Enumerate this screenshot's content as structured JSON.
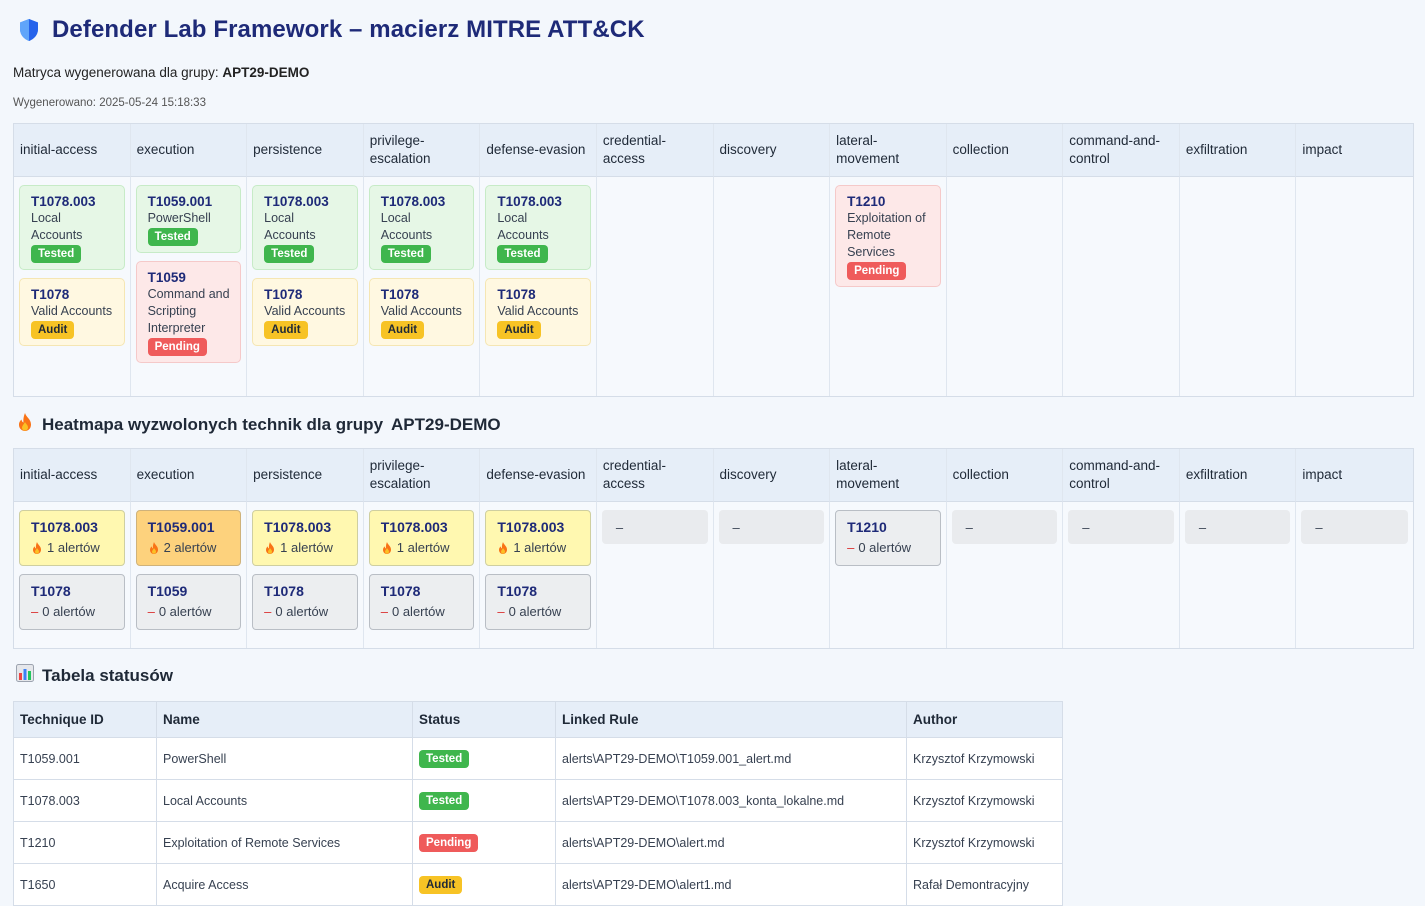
{
  "header": {
    "title": "Defender Lab Framework – macierz MITRE ATT&CK",
    "subtitle_prefix": "Matryca wygenerowana dla grupy:",
    "group": "APT29-DEMO",
    "generated": "Wygenerowano: 2025-05-24 15:18:33"
  },
  "tactics": [
    "initial-access",
    "execution",
    "persistence",
    "privilege-escalation",
    "defense-evasion",
    "credential-access",
    "discovery",
    "lateral-movement",
    "collection",
    "command-and-control",
    "exfiltration",
    "impact"
  ],
  "tactic_labels": [
    "initial-access",
    "execution",
    "persistence",
    "privilege-\nescalation",
    "defense-evasion",
    "credential-\naccess",
    "discovery",
    "lateral-\nmovement",
    "collection",
    "command-and-\ncontrol",
    "exfiltration",
    "impact"
  ],
  "matrix": [
    [
      {
        "id": "T1078.003",
        "name": "Local Accounts",
        "status": "Tested"
      },
      {
        "id": "T1078",
        "name": "Valid Accounts",
        "status": "Audit"
      }
    ],
    [
      {
        "id": "T1059.001",
        "name": "PowerShell",
        "status": "Tested"
      },
      {
        "id": "T1059",
        "name": "Command and Scripting Interpreter",
        "status": "Pending"
      }
    ],
    [
      {
        "id": "T1078.003",
        "name": "Local Accounts",
        "status": "Tested"
      },
      {
        "id": "T1078",
        "name": "Valid Accounts",
        "status": "Audit"
      }
    ],
    [
      {
        "id": "T1078.003",
        "name": "Local Accounts",
        "status": "Tested"
      },
      {
        "id": "T1078",
        "name": "Valid Accounts",
        "status": "Audit"
      }
    ],
    [
      {
        "id": "T1078.003",
        "name": "Local Accounts",
        "status": "Tested"
      },
      {
        "id": "T1078",
        "name": "Valid Accounts",
        "status": "Audit"
      }
    ],
    [],
    [],
    [
      {
        "id": "T1210",
        "name": "Exploitation of Remote Services",
        "status": "Pending"
      }
    ],
    [],
    [],
    [],
    []
  ],
  "heatmap_title_prefix": "Heatmapa wyzwolonych technik dla grupy",
  "heatmap": [
    [
      {
        "id": "T1078.003",
        "count": 1
      },
      {
        "id": "T1078",
        "count": 0
      }
    ],
    [
      {
        "id": "T1059.001",
        "count": 2
      },
      {
        "id": "T1059",
        "count": 0
      }
    ],
    [
      {
        "id": "T1078.003",
        "count": 1
      },
      {
        "id": "T1078",
        "count": 0
      }
    ],
    [
      {
        "id": "T1078.003",
        "count": 1
      },
      {
        "id": "T1078",
        "count": 0
      }
    ],
    [
      {
        "id": "T1078.003",
        "count": 1
      },
      {
        "id": "T1078",
        "count": 0
      }
    ],
    [],
    [],
    [
      {
        "id": "T1210",
        "count": 0
      }
    ],
    [],
    [],
    [],
    []
  ],
  "alerts_word": "alertów",
  "empty_placeholder": "–",
  "status_table": {
    "title": "Tabela statusów",
    "columns": [
      "Technique ID",
      "Name",
      "Status",
      "Linked Rule",
      "Author"
    ],
    "rows": [
      {
        "id": "T1059.001",
        "name": "PowerShell",
        "status": "Tested",
        "rule": "alerts\\APT29-DEMO\\T1059.001_alert.md",
        "author": "Krzysztof Krzymowski"
      },
      {
        "id": "T1078.003",
        "name": "Local Accounts",
        "status": "Tested",
        "rule": "alerts\\APT29-DEMO\\T1078.003_konta_lokalne.md",
        "author": "Krzysztof Krzymowski"
      },
      {
        "id": "T1210",
        "name": "Exploitation of Remote Services",
        "status": "Pending",
        "rule": "alerts\\APT29-DEMO\\alert.md",
        "author": "Krzysztof Krzymowski"
      },
      {
        "id": "T1650",
        "name": "Acquire Access",
        "status": "Audit",
        "rule": "alerts\\APT29-DEMO\\alert1.md",
        "author": "Rafał Demontracyjny"
      }
    ]
  },
  "colors": {
    "tested": "#3fb64d",
    "audit": "#f7c325",
    "pending": "#ef5b5b",
    "title": "#1e2a78"
  }
}
